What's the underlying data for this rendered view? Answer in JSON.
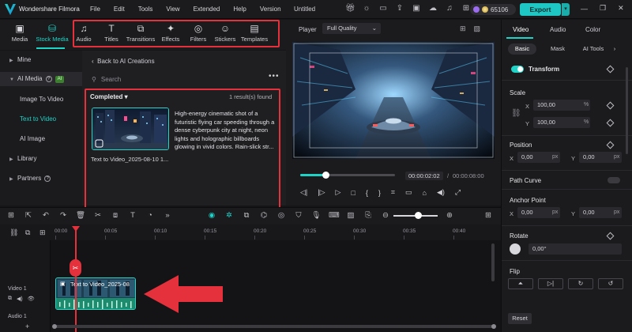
{
  "app": {
    "brand": "Wondershare Filmora",
    "doc_title": "Untitled",
    "credits": "65106",
    "export_label": "Export"
  },
  "menu": [
    "File",
    "Edit",
    "Tools",
    "View",
    "Extended",
    "Help",
    "Version"
  ],
  "media_tabs": [
    {
      "label": "Media",
      "icon": "media-icon"
    },
    {
      "label": "Stock Media",
      "icon": "stock-media-icon"
    },
    {
      "label": "Audio",
      "icon": "audio-icon"
    },
    {
      "label": "Titles",
      "icon": "titles-icon"
    },
    {
      "label": "Transitions",
      "icon": "transitions-icon"
    },
    {
      "label": "Effects",
      "icon": "effects-icon"
    },
    {
      "label": "Filters",
      "icon": "filters-icon"
    },
    {
      "label": "Stickers",
      "icon": "stickers-icon"
    },
    {
      "label": "Templates",
      "icon": "templates-icon"
    }
  ],
  "left_nav": {
    "mine": "Mine",
    "ai_media": "AI Media",
    "ai_badge": "AI",
    "image_to_video": "Image To Video",
    "text_to_video": "Text to Video",
    "ai_image": "AI Image",
    "library": "Library",
    "partners": "Partners"
  },
  "ai_panel": {
    "back_label": "Back to AI Creations",
    "search_placeholder": "Search",
    "filter_label": "Completed",
    "results_count": "1 result(s) found",
    "card_description": "High-energy cinematic shot of a futuristic flying car speeding through a dense cyberpunk city at night, neon lights and holographic billboards glowing in vivid colors. Rain-slick str...",
    "card_label": "Text to Video_2025-08-10 1..."
  },
  "player": {
    "label": "Player",
    "quality": "Full Quality",
    "current_time": "00:00:02:02",
    "separator": "/",
    "total_time": "00:00:08:00",
    "progress": 0.27
  },
  "props": {
    "tabs": [
      "Video",
      "Audio",
      "Color"
    ],
    "subtabs": [
      "Basic",
      "Mask",
      "AI Tools"
    ],
    "transform": "Transform",
    "scale": "Scale",
    "scale_x": "100,00",
    "scale_y": "100,00",
    "percent": "%",
    "position": "Position",
    "pos_x": "0,00",
    "pos_y": "0,00",
    "px": "px",
    "path_curve": "Path Curve",
    "anchor_point": "Anchor Point",
    "anchor_x": "0,00",
    "anchor_y": "0,00",
    "rotate": "Rotate",
    "rotate_value": "0,00°",
    "flip": "Flip",
    "reset": "Reset",
    "x": "X",
    "y": "Y"
  },
  "timeline": {
    "ruler": [
      "00:00",
      "00:05",
      "00:10",
      "00:15",
      "00:20",
      "00:25",
      "00:30",
      "00:35",
      "00:40"
    ],
    "video_track": "Video 1",
    "audio_track": "Audio 1",
    "clip_title": "Text to Video_2025-08"
  }
}
